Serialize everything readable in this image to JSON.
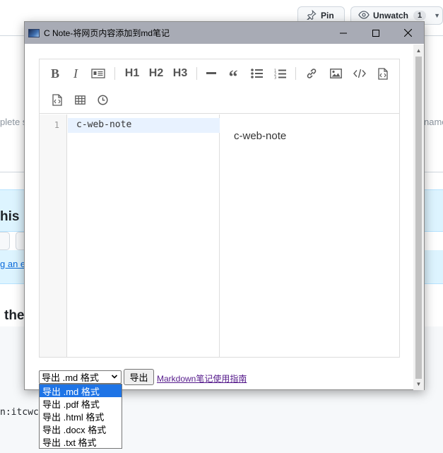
{
  "background": {
    "pin_label": "Pin",
    "unwatch_label": "Unwatch",
    "unwatch_count": "1",
    "left_fragment": "plete s",
    "right_fragment": "name",
    "heading_fragment": "his k",
    "link_fragment": "g an e",
    "subheading_fragment": "the",
    "code_fragment": "n:itcwc/"
  },
  "window": {
    "title": "C Note-将网页内容添加到md笔记",
    "minimize_icon": "minimize-icon",
    "maximize_icon": "maximize-icon",
    "close_icon": "close-icon"
  },
  "toolbar": {
    "h1": "H1",
    "h2": "H2",
    "h3": "H3"
  },
  "editor": {
    "line_number": "1",
    "code_line": "c-web-note",
    "preview_text": "c-web-note"
  },
  "footer": {
    "selected_option": "导出 .md 格式",
    "export_button": "导出",
    "guide_link": "Markdown笔记使用指南"
  },
  "dropdown": {
    "options": [
      "导出 .md 格式",
      "导出 .pdf 格式",
      "导出 .html 格式",
      "导出 .docx 格式",
      "导出 .txt 格式"
    ],
    "selected_index": 0
  },
  "colors": {
    "titlebar": "#a8abb5",
    "selection": "#1e74e6",
    "active_line": "#e8f2ff",
    "link_visited": "#551a8b"
  }
}
